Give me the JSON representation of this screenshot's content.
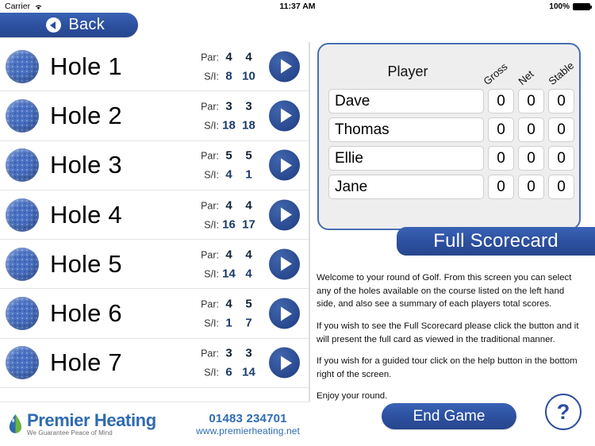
{
  "status_bar": {
    "carrier": "Carrier",
    "wifi_icon": "wifi-icon",
    "time": "11:37 AM",
    "battery_percent": "100%",
    "battery_icon": "battery-full-icon"
  },
  "nav": {
    "back_label": "Back",
    "back_icon": "back-arrow-icon"
  },
  "hole_list": {
    "par_label": "Par:",
    "si_label": "S/I:",
    "ball_icon": "golf-ball-icon",
    "go_icon": "play-arrow-icon",
    "holes": [
      {
        "name": "Hole 1",
        "par1": "4",
        "par2": "4",
        "si1": "8",
        "si2": "10"
      },
      {
        "name": "Hole 2",
        "par1": "3",
        "par2": "3",
        "si1": "18",
        "si2": "18"
      },
      {
        "name": "Hole 3",
        "par1": "5",
        "par2": "5",
        "si1": "4",
        "si2": "1"
      },
      {
        "name": "Hole 4",
        "par1": "4",
        "par2": "4",
        "si1": "16",
        "si2": "17"
      },
      {
        "name": "Hole 5",
        "par1": "4",
        "par2": "4",
        "si1": "14",
        "si2": "4"
      },
      {
        "name": "Hole 6",
        "par1": "4",
        "par2": "5",
        "si1": "1",
        "si2": "7"
      },
      {
        "name": "Hole 7",
        "par1": "3",
        "par2": "3",
        "si1": "6",
        "si2": "14"
      }
    ]
  },
  "sponsor": {
    "logo_icon": "water-drop-icon",
    "name": "Premier Heating",
    "tagline": "We Guarantee Peace of Mind",
    "phone": "01483 234701",
    "website": "www.premierheating.net",
    "brand_blue": "#2f6bb0",
    "brand_green": "#6cb33f"
  },
  "scorecard": {
    "player_header": "Player",
    "col_gross": "Gross",
    "col_net": "Net",
    "col_stable": "Stable",
    "players": [
      {
        "name": "Dave",
        "gross": "0",
        "net": "0",
        "stable": "0"
      },
      {
        "name": "Thomas",
        "gross": "0",
        "net": "0",
        "stable": "0"
      },
      {
        "name": "Ellie",
        "gross": "0",
        "net": "0",
        "stable": "0"
      },
      {
        "name": "Jane",
        "gross": "0",
        "net": "0",
        "stable": "0"
      }
    ],
    "full_scorecard_label": "Full Scorecard"
  },
  "instructions": {
    "p1": "Welcome to your round of Golf. From this screen you can select any of the holes available on the course listed on the left hand side, and also see a summary of each players total scores.",
    "p2": "If you wish to see the Full Scorecard please click the button and it will present the full card as viewed in the traditional manner.",
    "p3": "If you wish for a guided tour click on the help button in the bottom right of the screen.",
    "p4": "Enjoy your round."
  },
  "footer": {
    "end_game_label": "End Game",
    "help_label": "?"
  },
  "theme": {
    "primary_blue": "#2c4f9e",
    "panel_bg": "#eeeeee",
    "ball_blue": "#4a72c4"
  }
}
